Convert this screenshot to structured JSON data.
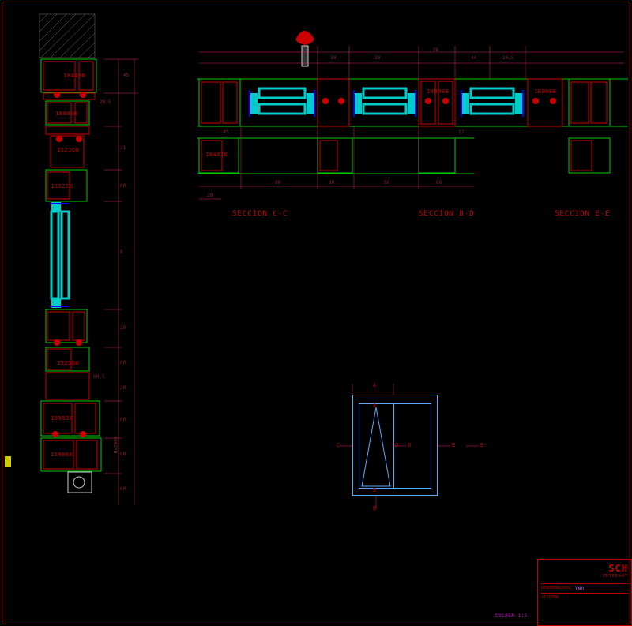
{
  "drawing": {
    "sections": {
      "cc": "SECCION C-C",
      "dd": "SECCION D-D",
      "ee": "SECCION E-E"
    },
    "part_numbers_vertical": [
      "184400",
      "189060",
      "152160",
      "189230",
      "152160",
      "189930",
      "159060"
    ],
    "part_numbers_horizontal": [
      "184420",
      "189080",
      "189080"
    ],
    "dimensions_vertical": [
      "45",
      "29,5",
      "21",
      "80",
      "8",
      "28",
      "80",
      "28",
      "60,5",
      "80",
      "88",
      "60"
    ],
    "dimensions_horizontal": [
      "39",
      "39",
      "56",
      "44",
      "20,5",
      "80",
      "80",
      "80",
      "12",
      "45",
      "68",
      "28"
    ],
    "key_labels": [
      "A",
      "A",
      "B",
      "B",
      "C",
      "D",
      "D",
      "E",
      "E"
    ],
    "axis_label": "H=2000"
  },
  "title_block": {
    "logo": "SCH",
    "sub": "INTERNAT",
    "fields": {
      "denominacion_lbl": "DENOMINACION:",
      "denominacion_val": "Ven",
      "sistema_lbl": "SISTEMA:",
      "sistema_val": ""
    },
    "scale_lbl": "ESCALA",
    "scale_val": "1:1"
  }
}
